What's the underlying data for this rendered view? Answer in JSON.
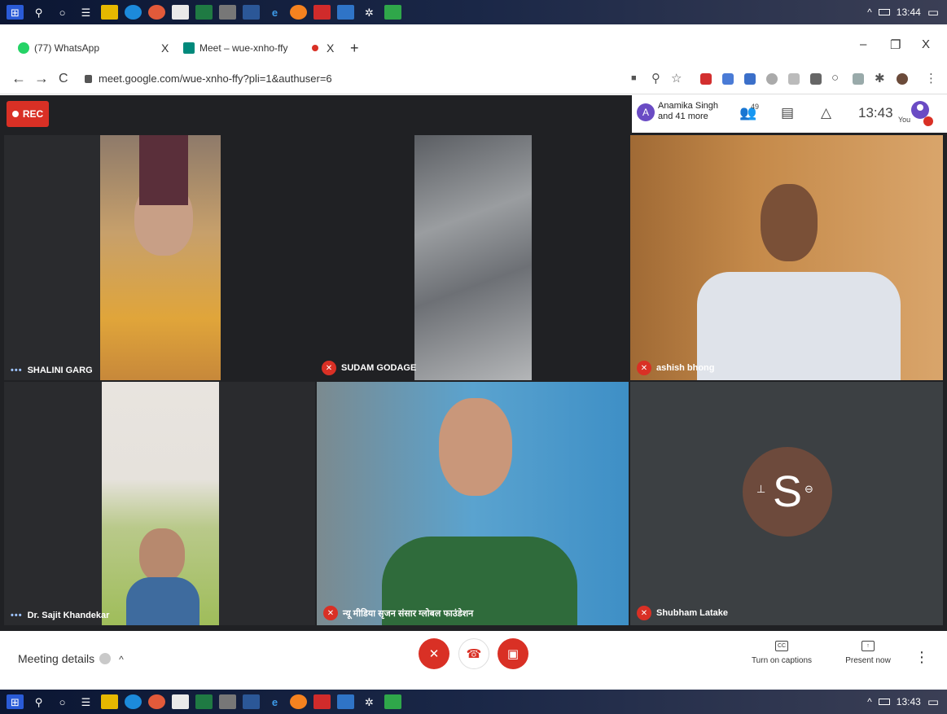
{
  "taskbar_top": {
    "time": "13:44"
  },
  "taskbar_bottom": {
    "time": "13:43"
  },
  "browser": {
    "tabs": [
      {
        "label": "(77) WhatsApp",
        "close": "X"
      },
      {
        "label": "Meet – wue-xnho-ffy",
        "close": "X"
      }
    ],
    "new_tab": "+",
    "window_controls": {
      "minimize": "–",
      "restore": "❐",
      "close": "X"
    },
    "url": "meet.google.com/wue-xnho-ffy?pli=1&authuser=6"
  },
  "meet": {
    "rec_label": "REC",
    "attendees": {
      "avatar_letter": "A",
      "line1": "Anamika Singh",
      "line2": "and 41 more"
    },
    "people_count": "49",
    "clock": "13:43",
    "you_label": "You",
    "tiles": [
      {
        "name": "SHALINI GARG",
        "state": "speaking"
      },
      {
        "name": "SUDAM GODAGE",
        "state": "muted"
      },
      {
        "name": "ashish bhong",
        "state": "muted"
      },
      {
        "name": "Dr. Sajit Khandekar",
        "state": "speaking"
      },
      {
        "name": "न्यू मीडिया सृजन संसार ग्लोबल फाउंडेशन",
        "state": "muted"
      },
      {
        "name": "Shubham Latake",
        "state": "muted",
        "avatar_letter": "S"
      }
    ],
    "bottom": {
      "meeting_details": "Meeting details",
      "captions_label": "Turn on captions",
      "captions_icon": "CC",
      "present_label": "Present now"
    }
  },
  "colors": {
    "meet_bg": "#202124",
    "red": "#d93025",
    "avatar_brown": "#6d4a3c"
  }
}
